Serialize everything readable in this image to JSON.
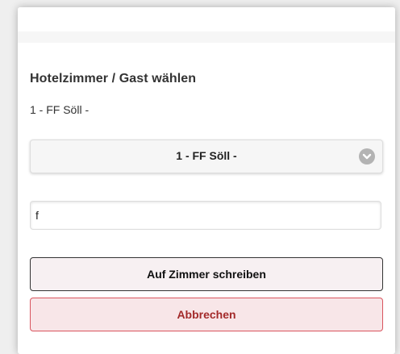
{
  "dialog": {
    "title": "Hotelzimmer / Gast wählen",
    "current_room": "1 - FF Söll -",
    "room_select": {
      "selected": "1 - FF Söll -",
      "icon": "chevron-down-icon"
    },
    "search_input": {
      "value": "f"
    },
    "buttons": {
      "primary_label": "Auf Zimmer schreiben",
      "cancel_label": "Abbrechen"
    }
  },
  "colors": {
    "cancel_text": "#a32a2a",
    "cancel_border": "#d9545e",
    "cancel_bg": "#f8e6e8",
    "primary_border": "#333333",
    "select_bg": "#f6f6f6"
  }
}
